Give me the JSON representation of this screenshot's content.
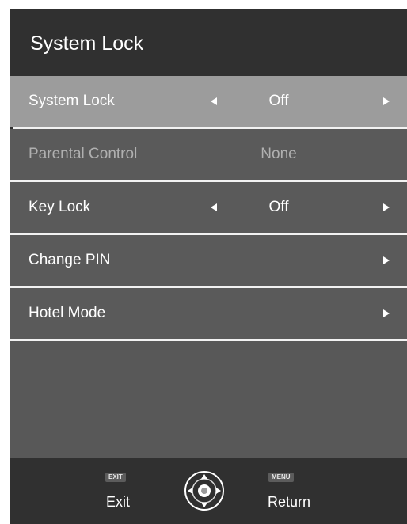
{
  "header": {
    "title": "System Lock"
  },
  "menu": {
    "items": [
      {
        "label": "System Lock",
        "value": "Off",
        "has_left_arrow": true,
        "has_right_arrow": true,
        "selected": true,
        "enabled": true
      },
      {
        "label": "Parental Control",
        "value": "None",
        "has_left_arrow": false,
        "has_right_arrow": false,
        "selected": false,
        "enabled": false
      },
      {
        "label": "Key Lock",
        "value": "Off",
        "has_left_arrow": true,
        "has_right_arrow": true,
        "selected": false,
        "enabled": true
      },
      {
        "label": "Change PIN",
        "value": "",
        "has_left_arrow": false,
        "has_right_arrow": true,
        "selected": false,
        "enabled": true
      },
      {
        "label": "Hotel Mode",
        "value": "",
        "has_left_arrow": false,
        "has_right_arrow": true,
        "selected": false,
        "enabled": true
      }
    ]
  },
  "footer": {
    "exit_key": "EXIT",
    "exit_label": "Exit",
    "menu_key": "MENU",
    "return_label": "Return",
    "nav_icon": "navigation-pad-icon"
  },
  "colors": {
    "header_bg": "#303030",
    "panel_bg": "#5a5a5a",
    "selected_bg": "#9c9c9c",
    "disabled_text": "#b0b0b0",
    "divider": "#f2f2f2"
  }
}
